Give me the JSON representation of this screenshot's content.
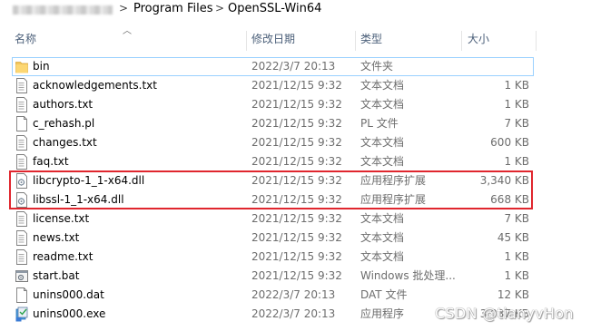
{
  "breadcrumb": {
    "items": [
      "Program Files",
      "OpenSSL-Win64"
    ],
    "separator": ">"
  },
  "header": {
    "name": "名称",
    "date": "修改日期",
    "type": "类型",
    "size": "大小"
  },
  "files": [
    {
      "name": "bin",
      "date": "2022/3/7 20:13",
      "type": "文件夹",
      "size": "",
      "icon": "folder-icon"
    },
    {
      "name": "acknowledgements.txt",
      "date": "2021/12/15 9:32",
      "type": "文本文档",
      "size": "1 KB",
      "icon": "text-file-icon"
    },
    {
      "name": "authors.txt",
      "date": "2021/12/15 9:32",
      "type": "文本文档",
      "size": "1 KB",
      "icon": "text-file-icon"
    },
    {
      "name": "c_rehash.pl",
      "date": "2021/12/15 9:32",
      "type": "PL 文件",
      "size": "7 KB",
      "icon": "blank-file-icon"
    },
    {
      "name": "changes.txt",
      "date": "2021/12/15 9:32",
      "type": "文本文档",
      "size": "600 KB",
      "icon": "text-file-icon"
    },
    {
      "name": "faq.txt",
      "date": "2021/12/15 9:32",
      "type": "文本文档",
      "size": "1 KB",
      "icon": "text-file-icon"
    },
    {
      "name": "libcrypto-1_1-x64.dll",
      "date": "2021/12/15 9:32",
      "type": "应用程序扩展",
      "size": "3,340 KB",
      "icon": "dll-file-icon"
    },
    {
      "name": "libssl-1_1-x64.dll",
      "date": "2021/12/15 9:32",
      "type": "应用程序扩展",
      "size": "668 KB",
      "icon": "dll-file-icon"
    },
    {
      "name": "license.txt",
      "date": "2021/12/15 9:32",
      "type": "文本文档",
      "size": "7 KB",
      "icon": "text-file-icon"
    },
    {
      "name": "news.txt",
      "date": "2021/12/15 9:32",
      "type": "文本文档",
      "size": "45 KB",
      "icon": "text-file-icon"
    },
    {
      "name": "readme.txt",
      "date": "2021/12/15 9:32",
      "type": "文本文档",
      "size": "1 KB",
      "icon": "text-file-icon"
    },
    {
      "name": "start.bat",
      "date": "2021/12/15 9:32",
      "type": "Windows 批处理...",
      "size": "1 KB",
      "icon": "batch-file-icon"
    },
    {
      "name": "unins000.dat",
      "date": "2022/3/7 20:13",
      "type": "DAT 文件",
      "size": "12 KB",
      "icon": "blank-file-icon"
    },
    {
      "name": "unins000.exe",
      "date": "2022/3/7 20:13",
      "type": "应用程序",
      "size": "3,037 KB",
      "icon": "installer-exe-icon"
    }
  ],
  "watermark": "CSDN @tianyvHon",
  "colors": {
    "highlight": "#e0262e",
    "selection_border": "#99d1ff",
    "folder": "#f2c55c"
  }
}
